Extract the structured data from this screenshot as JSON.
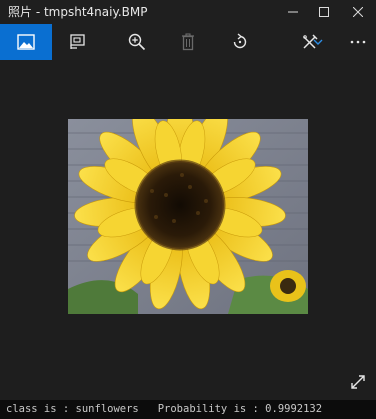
{
  "window": {
    "title": "照片 - tmpsht4naiy.BMP"
  },
  "title_buttons": {
    "minimize_icon": "minimize-icon",
    "maximize_icon": "maximize-icon",
    "close_icon": "close-icon"
  },
  "toolbar": {
    "items": [
      {
        "icon": "image-icon",
        "active": true
      },
      {
        "icon": "slideshow-icon"
      },
      {
        "icon": "zoom-in-icon"
      },
      {
        "icon": "delete-icon",
        "disabled": true
      },
      {
        "icon": "rotate-icon"
      },
      {
        "icon": "edit-icon"
      },
      {
        "icon": "chevron-down-icon"
      },
      {
        "icon": "more-icon"
      }
    ],
    "accent": "#0a6fd1"
  },
  "photo": {
    "subject": "sunflower",
    "petal_color": "#f3cf1b",
    "center_color": "#2a1a08"
  },
  "console": {
    "text": "class is : sunflowers   Probability is : 0.9992132"
  },
  "colors": {
    "window_bg": "#1e1e1e",
    "titlebar_bg": "#1f1f1f",
    "console_bg": "#0c0c0c"
  }
}
